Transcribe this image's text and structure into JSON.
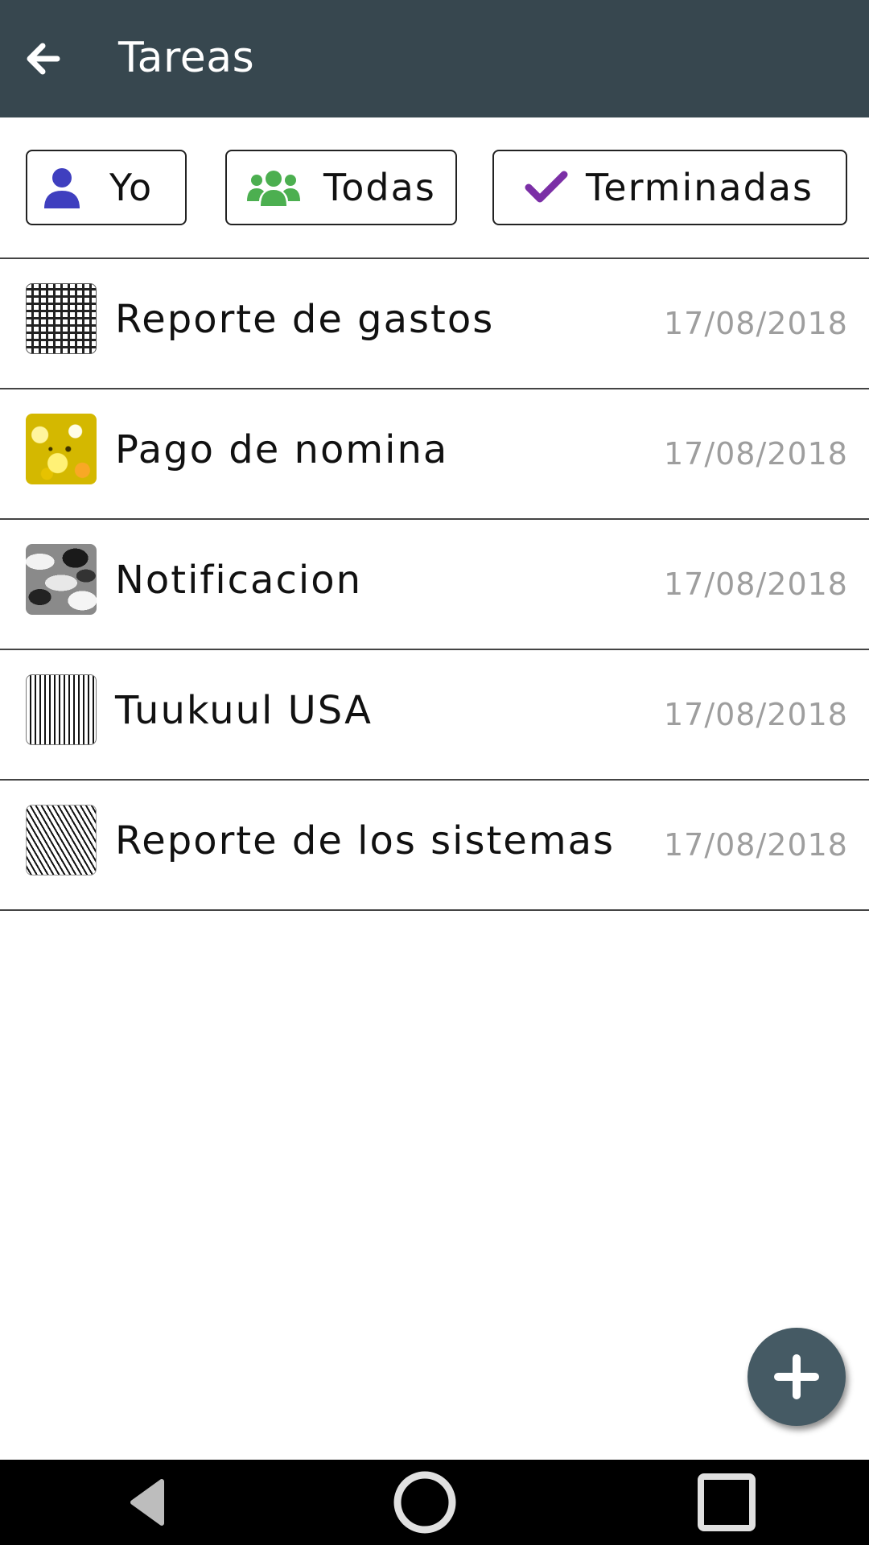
{
  "app_bar": {
    "title": "Tareas",
    "back_icon": "arrow-left-icon",
    "background": "#37474f"
  },
  "filters": [
    {
      "label": "Yo",
      "icon": "user-icon",
      "icon_color": "#3f3fbf"
    },
    {
      "label": "Todas",
      "icon": "users-group-icon",
      "icon_color": "#4caf50"
    },
    {
      "label": "Terminadas",
      "icon": "check-icon",
      "icon_color": "#7b2fa6"
    }
  ],
  "tasks": [
    {
      "title": "Reporte de gastos",
      "date": "17/08/2018",
      "thumbnail": "maze-pattern"
    },
    {
      "title": "Pago de nomina",
      "date": "17/08/2018",
      "thumbnail": "yellow-flowers-photo"
    },
    {
      "title": "Notificacion",
      "date": "17/08/2018",
      "thumbnail": "camouflage-pattern"
    },
    {
      "title": "Tuukuul USA",
      "date": "17/08/2018",
      "thumbnail": "vertical-lines-pattern"
    },
    {
      "title": "Reporte de los sistemas",
      "date": "17/08/2018",
      "thumbnail": "diagonal-lines-pattern"
    }
  ],
  "fab": {
    "icon": "plus-icon",
    "background": "#455a64"
  },
  "system_nav": {
    "back_icon": "nav-back-triangle-icon",
    "home_icon": "nav-home-circle-icon",
    "recents_icon": "nav-recents-square-icon"
  }
}
